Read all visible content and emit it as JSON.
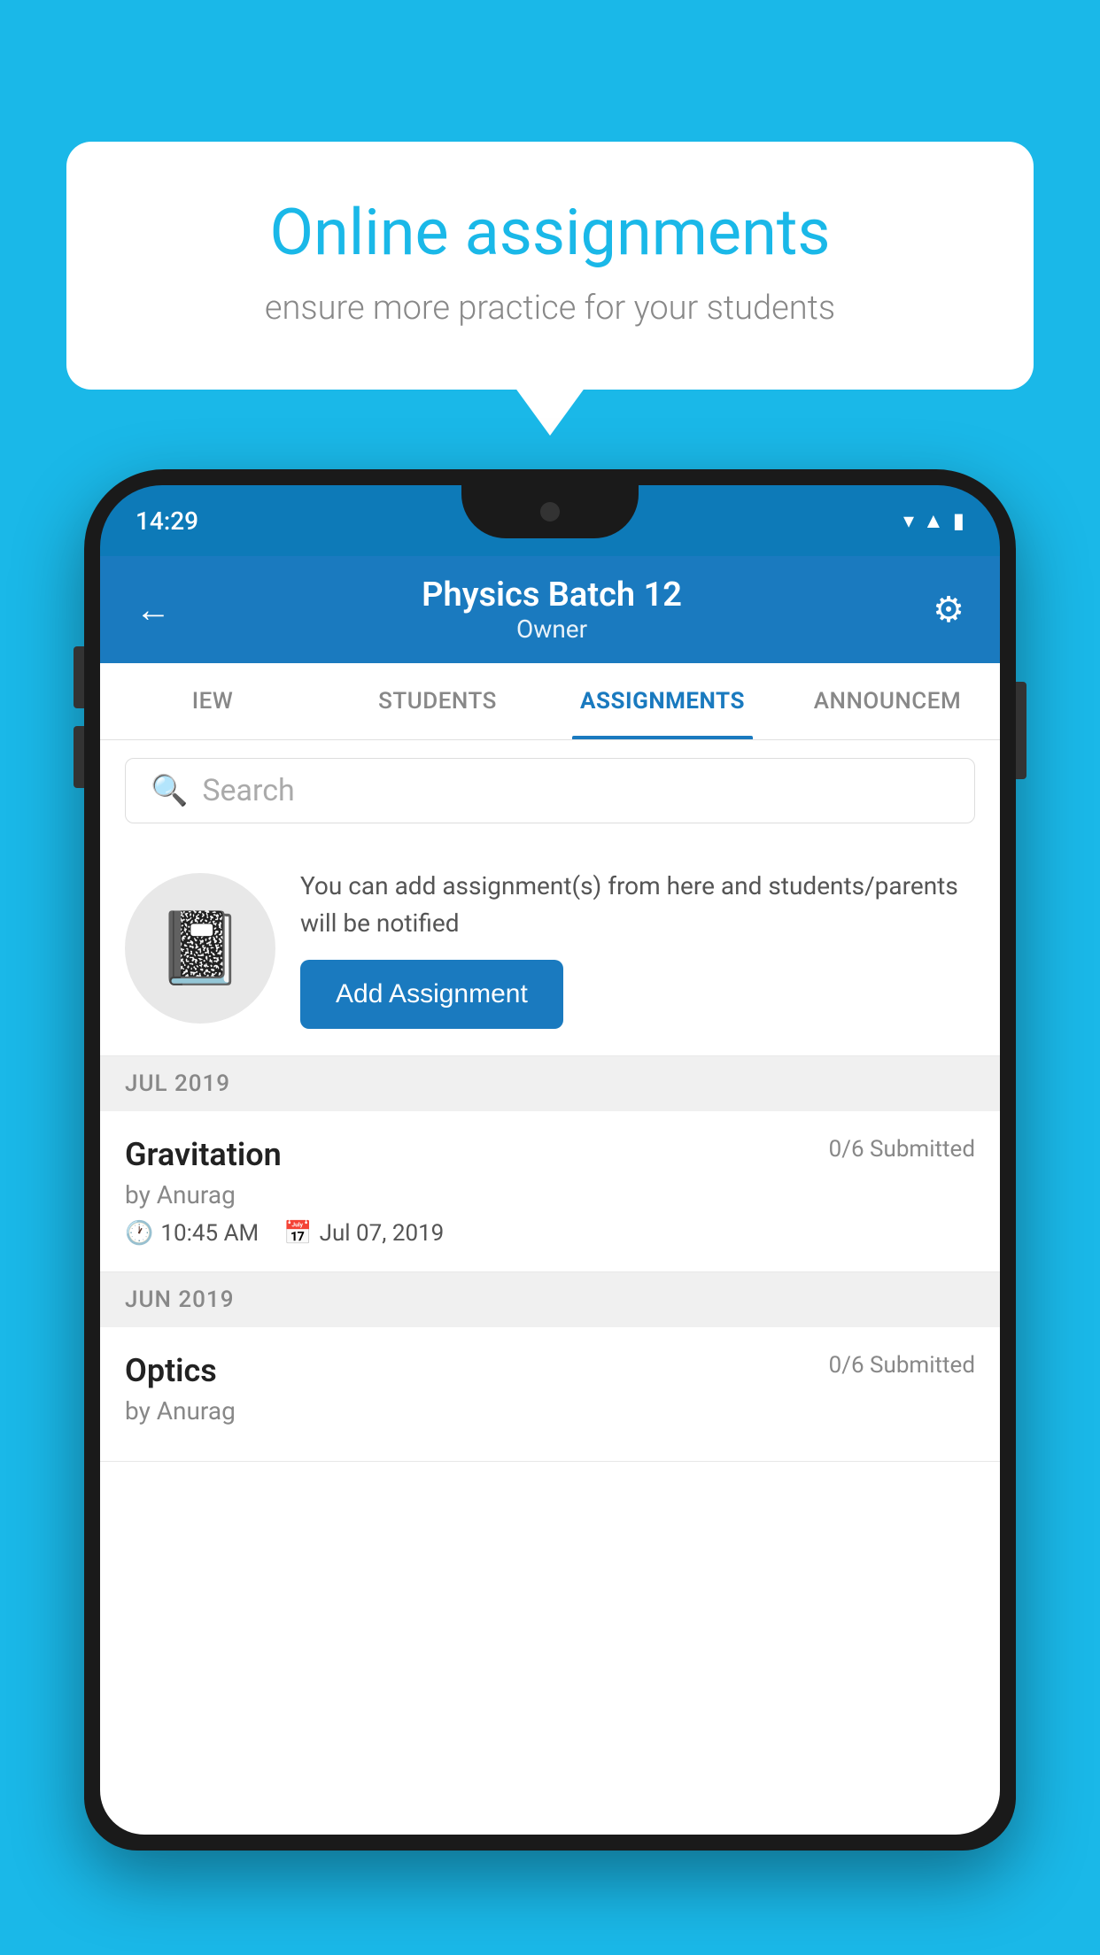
{
  "background_color": "#1ab8e8",
  "speech_bubble": {
    "title": "Online assignments",
    "subtitle": "ensure more practice for your students"
  },
  "phone": {
    "status_bar": {
      "time": "14:29"
    },
    "header": {
      "title": "Physics Batch 12",
      "subtitle": "Owner"
    },
    "tabs": [
      {
        "label": "IEW",
        "active": false
      },
      {
        "label": "STUDENTS",
        "active": false
      },
      {
        "label": "ASSIGNMENTS",
        "active": true
      },
      {
        "label": "ANNOUNCEM",
        "active": false
      }
    ],
    "search": {
      "placeholder": "Search"
    },
    "promo": {
      "text": "You can add assignment(s) from here and students/parents will be notified",
      "button_label": "Add Assignment"
    },
    "sections": [
      {
        "label": "JUL 2019",
        "assignments": [
          {
            "name": "Gravitation",
            "submitted": "0/6 Submitted",
            "author": "by Anurag",
            "time": "10:45 AM",
            "date": "Jul 07, 2019"
          }
        ]
      },
      {
        "label": "JUN 2019",
        "assignments": [
          {
            "name": "Optics",
            "submitted": "0/6 Submitted",
            "author": "by Anurag",
            "time": "",
            "date": ""
          }
        ]
      }
    ]
  }
}
